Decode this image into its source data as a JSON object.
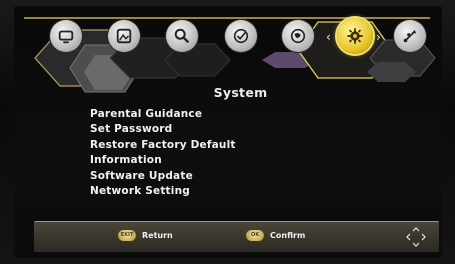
{
  "topbar": {
    "tabs": [
      {
        "name": "tv-icon"
      },
      {
        "name": "picture-icon"
      },
      {
        "name": "search-icon"
      },
      {
        "name": "clock-icon"
      },
      {
        "name": "language-icon"
      },
      {
        "name": "gear-icon",
        "active": true
      },
      {
        "name": "usb-icon"
      }
    ],
    "left_arrow": "‹",
    "right_arrow": "›"
  },
  "page_title": "System",
  "menu_items": [
    "Parental Guidance",
    "Set Password",
    "Restore Factory Default",
    "Information",
    "Software Update",
    "Network Setting"
  ],
  "bottombar": {
    "return_label": "Return",
    "confirm_label": "Confirm",
    "return_key": "EXIT",
    "confirm_key": "OK"
  },
  "colors": {
    "accent": "#e8c62a",
    "gold_line": "#c9ad5c",
    "text": "#f2f2f2"
  }
}
